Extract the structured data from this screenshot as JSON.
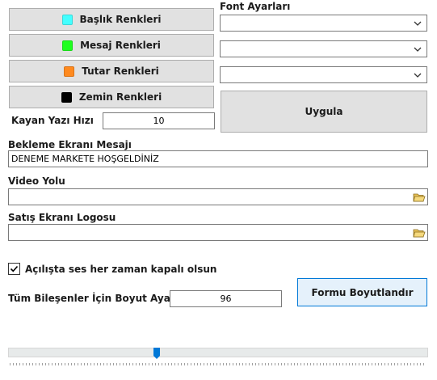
{
  "color_buttons": [
    {
      "label": "Başlık Renkleri",
      "swatch": "#44ffff"
    },
    {
      "label": "Mesaj Renkleri",
      "swatch": "#1fff1f"
    },
    {
      "label": "Tutar Renkleri",
      "swatch": "#ff8a1f"
    },
    {
      "label": "Zemin Renkleri",
      "swatch": "#000000"
    }
  ],
  "font_settings": {
    "label": "Font Ayarları",
    "selects": [
      "",
      "",
      ""
    ]
  },
  "apply_button": "Uygula",
  "scroll_speed": {
    "label": "Kayan Yazı Hızı",
    "value": "10"
  },
  "waiting_message": {
    "label": "Bekleme Ekranı Mesajı",
    "value": "DENEME MARKETE HOŞGELDİNİZ"
  },
  "video_path": {
    "label": "Video Yolu",
    "value": ""
  },
  "sales_logo": {
    "label": "Satış Ekranı Logosu",
    "value": ""
  },
  "mute_on_start": {
    "label": "Açılışta ses her zaman kapalı olsun",
    "checked": true
  },
  "component_size": {
    "label": "Tüm Bileşenler İçin Boyut Ayarla",
    "value": "96"
  },
  "resize_button": "Formu Boyutlandır",
  "size_slider": {
    "value_fraction": 0.35
  },
  "icons": [
    "chevron-down-icon",
    "folder-open-icon",
    "checkmark-icon",
    "slider-thumb-icon"
  ],
  "colors": {
    "accent": "#0078d7",
    "button_bg": "#e1e1e1",
    "focus_bg": "#e5f1fb"
  }
}
